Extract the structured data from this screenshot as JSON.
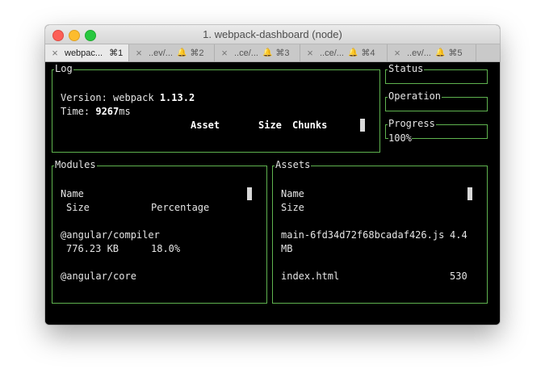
{
  "window": {
    "title": "1. webpack-dashboard (node)"
  },
  "tabs": [
    {
      "label": "webpac...",
      "shortcut": "⌘1",
      "active": true,
      "bell": false
    },
    {
      "label": "..ev/...",
      "shortcut": "⌘2",
      "active": false,
      "bell": true
    },
    {
      "label": "..ce/...",
      "shortcut": "⌘3",
      "active": false,
      "bell": true
    },
    {
      "label": "..ce/...",
      "shortcut": "⌘4",
      "active": false,
      "bell": true
    },
    {
      "label": "..ev/...",
      "shortcut": "⌘5",
      "active": false,
      "bell": true
    }
  ],
  "log": {
    "title": "Log",
    "version_label": "Version: webpack ",
    "version_value": "1.13.2",
    "time_label": "Time: ",
    "time_value": "9267",
    "time_unit": "ms",
    "columns": [
      "Asset",
      "Size",
      "Chunks"
    ]
  },
  "status": {
    "title": "Status",
    "value": ""
  },
  "operation": {
    "title": "Operation",
    "value": ""
  },
  "progress": {
    "title": "Progress",
    "value": "100%"
  },
  "modules": {
    "title": "Modules",
    "col_name": "Name",
    "col_size": "Size",
    "col_percentage": "Percentage",
    "rows": [
      {
        "name": "@angular/compiler",
        "size": "776.23 KB",
        "percentage": "18.0%"
      },
      {
        "name": "@angular/core",
        "size": "",
        "percentage": ""
      }
    ]
  },
  "assets": {
    "title": "Assets",
    "col_name": "Name",
    "col_size": "Size",
    "rows": [
      {
        "name": "main-6fd34d72f68bcadaf426.js",
        "size_part1": "4.4",
        "size_part2": "MB"
      },
      {
        "name": "index.html",
        "size": "530"
      }
    ]
  },
  "colors": {
    "border": "#5fb34f",
    "background": "#000000",
    "text": "#e5e5e5"
  }
}
